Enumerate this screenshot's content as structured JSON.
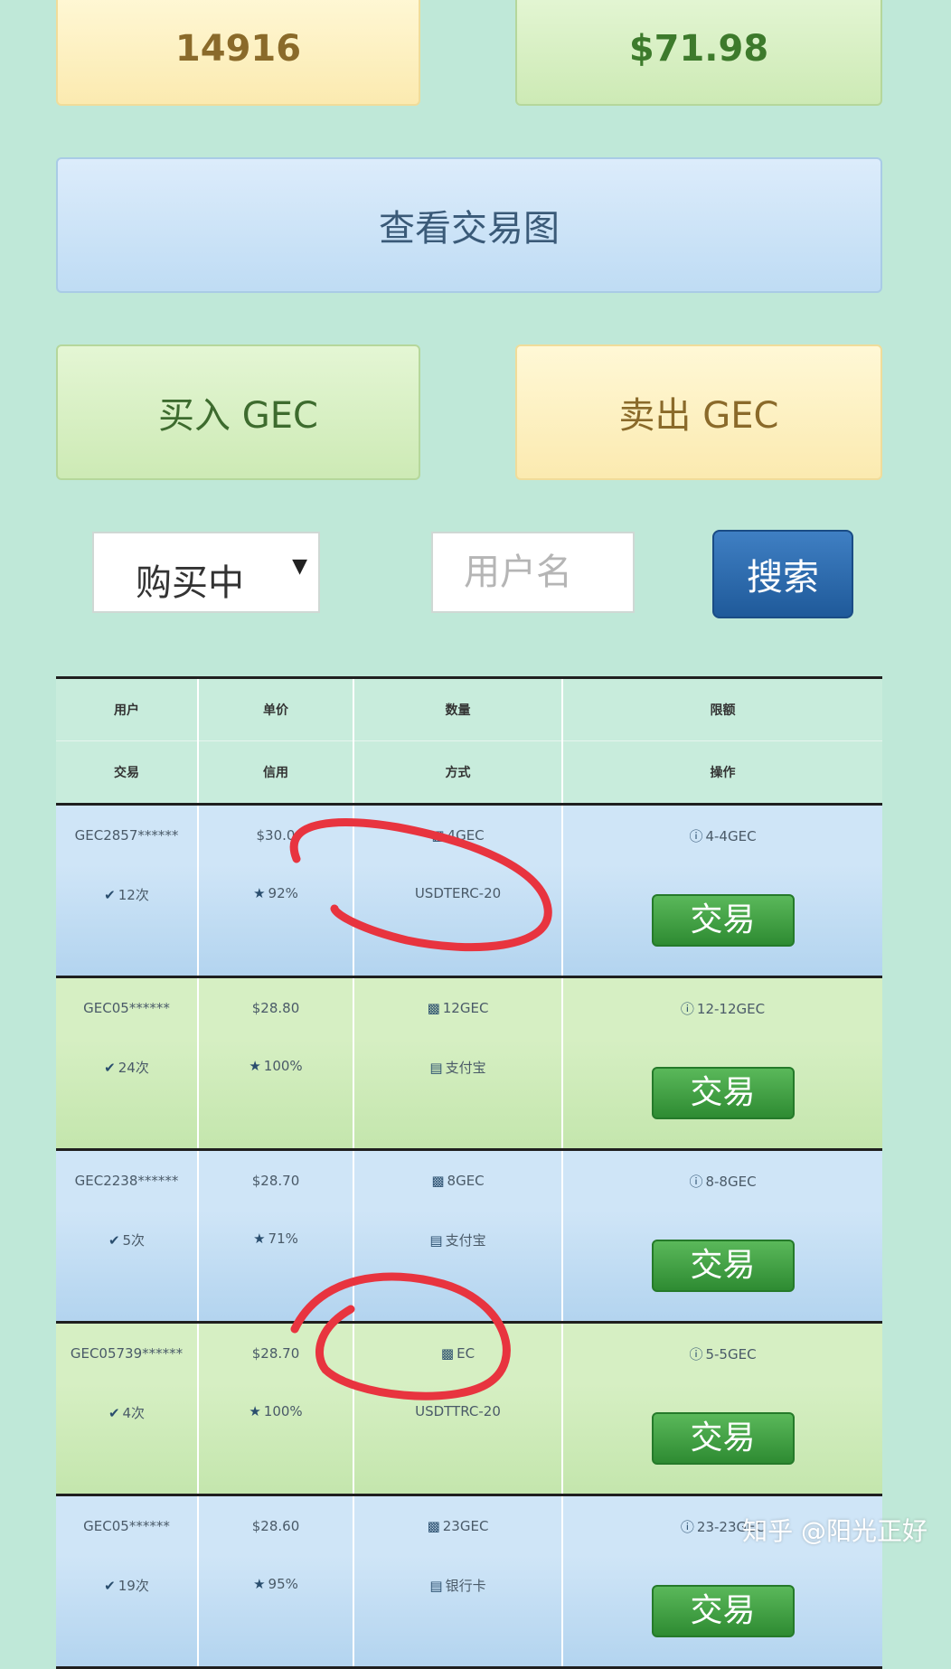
{
  "stats": {
    "left_value": "14916",
    "right_value": "$71.98"
  },
  "buttons": {
    "chart": "查看交易图",
    "buy": "买入 GEC",
    "sell": "卖出 GEC",
    "search": "搜索",
    "trade": "交易"
  },
  "filter": {
    "selected": "购买中",
    "arrow": "▼",
    "username_placeholder": "用户名"
  },
  "table": {
    "headers_row1": [
      "用户",
      "单价",
      "数量",
      "限额"
    ],
    "headers_row2": [
      "交易",
      "信用",
      "方式",
      "操作"
    ],
    "rows": [
      {
        "theme": "blue",
        "user": "GEC2857******",
        "price": "$30.0",
        "qty": "4GEC",
        "limit": "4-4GEC",
        "trades": "12次",
        "credit": "92%",
        "method": "USDTERC-20",
        "method_icon": ""
      },
      {
        "theme": "green",
        "user": "GEC05******",
        "price": "$28.80",
        "qty": "12GEC",
        "limit": "12-12GEC",
        "trades": "24次",
        "credit": "100%",
        "method": "支付宝",
        "method_icon": "card-icon"
      },
      {
        "theme": "blue",
        "user": "GEC2238******",
        "price": "$28.70",
        "qty": "8GEC",
        "limit": "8-8GEC",
        "trades": "5次",
        "credit": "71%",
        "method": "支付宝",
        "method_icon": "card-icon"
      },
      {
        "theme": "green",
        "user": "GEC05739******",
        "price": "$28.70",
        "qty": "EC",
        "limit": "5-5GEC",
        "trades": "4次",
        "credit": "100%",
        "method": "USDTTRC-20",
        "method_icon": ""
      },
      {
        "theme": "blue",
        "user": "GEC05******",
        "price": "$28.60",
        "qty": "23GEC",
        "limit": "23-23GEC",
        "trades": "19次",
        "credit": "95%",
        "method": "银行卡",
        "method_icon": "card-icon"
      }
    ]
  },
  "watermark": "知乎 @阳光正好",
  "colors": {
    "accent_blue": "#1f5a9a",
    "trade_green": "#2e8b32",
    "annotation_red": "#e8343f"
  }
}
